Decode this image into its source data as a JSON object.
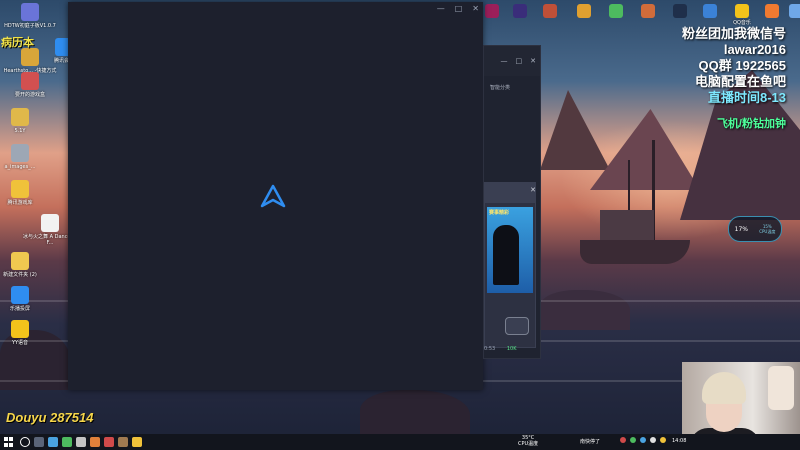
{
  "overlay": {
    "left_label": "病历本",
    "promo": [
      "粉丝团加我微信号",
      "lawar2016",
      "QQ群 1922565",
      "电脑配置在鱼吧",
      "直播时间8-13",
      "飞机/粉钻加钟"
    ],
    "watermark": "Douyu 287514"
  },
  "desktop_icons": [
    {
      "label": "HDTW初庭子板V1.0.7",
      "icon": "app-icon",
      "color": "#6a74d8"
    },
    {
      "label": "Hearthsto... -快捷方式",
      "icon": "hearthstone-icon",
      "color": "#d8a63a"
    },
    {
      "label": "腾讯会议",
      "icon": "meeting-icon",
      "color": "#2f8df0"
    },
    {
      "label": "要开的游戏盒",
      "icon": "game-box-icon",
      "color": "#d25050"
    },
    {
      "label": "5.1Y",
      "icon": "folder-icon",
      "color": "#e0b84a"
    },
    {
      "label": "a_images_...",
      "icon": "image-icon",
      "color": "#9da7b5"
    },
    {
      "label": "腾讯游戏库",
      "icon": "tencent-games-icon",
      "color": "#f0c23a"
    },
    {
      "label": "冰与火之舞 A Dance of F...",
      "icon": "file-icon",
      "color": "#f2f2f2"
    },
    {
      "label": "新建文件夹 (2)",
      "icon": "new-folder-icon",
      "color": "#f0c850"
    },
    {
      "label": "乐播投屏",
      "icon": "cast-icon",
      "color": "#2f8df0"
    },
    {
      "label": "YY语音",
      "icon": "yy-icon",
      "color": "#f2c31b"
    }
  ],
  "top_icons": [
    {
      "label": "",
      "icon": "pr-icon",
      "color": "#9b1f5a"
    },
    {
      "label": "",
      "icon": "pr2-icon",
      "color": "#3a2d7a"
    },
    {
      "label": "",
      "icon": "game-icon",
      "color": "#c05038"
    },
    {
      "label": "",
      "icon": "browser-icon",
      "color": "#e0a030"
    },
    {
      "label": "",
      "icon": "wechat-icon",
      "color": "#4dbb5f"
    },
    {
      "label": "",
      "icon": "app2-icon",
      "color": "#d06c3a"
    },
    {
      "label": "",
      "icon": "steam-icon",
      "color": "#1f2f4a"
    },
    {
      "label": "",
      "icon": "app3-icon",
      "color": "#3b82d6"
    },
    {
      "label": "QQ音乐",
      "icon": "qqmusic-icon",
      "color": "#f2c31b"
    },
    {
      "label": "",
      "icon": "app4-icon",
      "color": "#f07a30"
    },
    {
      "label": "",
      "icon": "app5-icon",
      "color": "#6fa8e8"
    }
  ],
  "launcher": {
    "min": "—",
    "max": "□",
    "close": "✕"
  },
  "window2": {
    "min": "—",
    "max": "□",
    "close": "✕",
    "search_label": "智能分类",
    "banner_tag": "赛事精彩",
    "status_left": "0:53",
    "status_right": "10K",
    "panel_close": "✕"
  },
  "cpu_widget": {
    "percent": "17%",
    "sub_a": "15%",
    "sub_b": "CPU温度"
  },
  "taskbar": {
    "temp": "35°C",
    "temp_label": "CPU温度",
    "tray_text": "南快停了",
    "clock": "14:08"
  }
}
